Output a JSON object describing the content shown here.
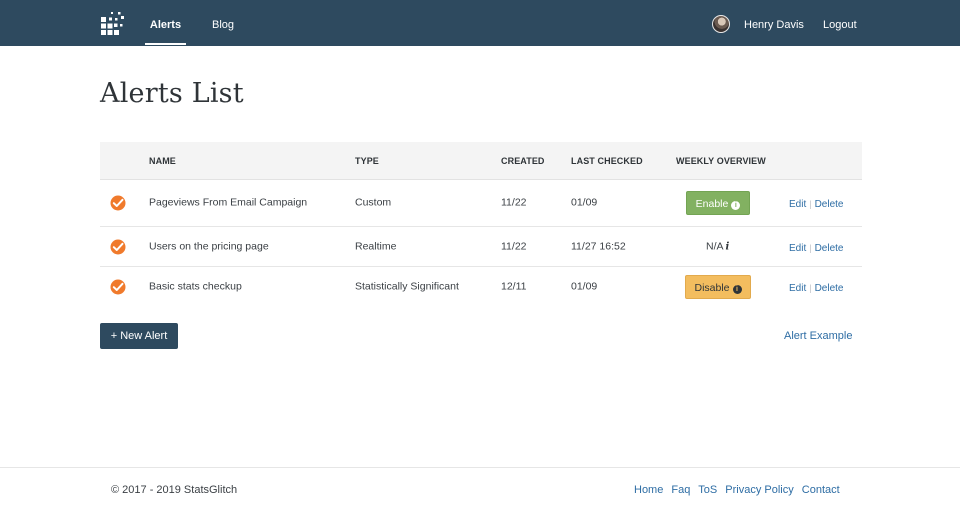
{
  "nav": {
    "logo_icon": "stats-dots-logo-icon",
    "items": [
      {
        "label": "Alerts",
        "active": true
      },
      {
        "label": "Blog",
        "active": false
      }
    ],
    "user_name": "Henry Davis",
    "logout": "Logout"
  },
  "page_title": "Alerts List",
  "table": {
    "headers": [
      "NAME",
      "TYPE",
      "CREATED",
      "LAST CHECKED",
      "WEEKLY OVERVIEW"
    ],
    "rows": [
      {
        "status_icon": "check-badge-icon",
        "name": "Pageviews From Email Campaign",
        "type": "Custom",
        "created": "11/22",
        "last_checked": "01/09",
        "weekly_overview": "Enable",
        "edit": "Edit",
        "delete": "Delete"
      },
      {
        "status_icon": "check-badge-icon",
        "name": "Users on the pricing page",
        "type": "Realtime",
        "created": "11/22",
        "last_checked": "11/27 16:52",
        "weekly_overview": "N/A",
        "edit": "Edit",
        "delete": "Delete"
      },
      {
        "status_icon": "check-badge-icon",
        "name": "Basic stats checkup",
        "type": "Statistically Significant",
        "created": "12/11",
        "last_checked": "01/09",
        "weekly_overview": "Disable",
        "edit": "Edit",
        "delete": "Delete"
      }
    ],
    "separator": "|"
  },
  "new_alert_button": "+ New Alert",
  "alert_example_link": "Alert Example",
  "footer": {
    "copyright": "© 2017 - 2019 StatsGlitch",
    "links": [
      "Home",
      "Faq",
      "ToS",
      "Privacy Policy",
      "Contact"
    ]
  },
  "colors": {
    "nav_bg": "#2e4a5f",
    "enable_bg": "#82b161",
    "disable_bg": "#f3bd5f",
    "link": "#2e6da4",
    "status_icon": "#f07a2c"
  }
}
